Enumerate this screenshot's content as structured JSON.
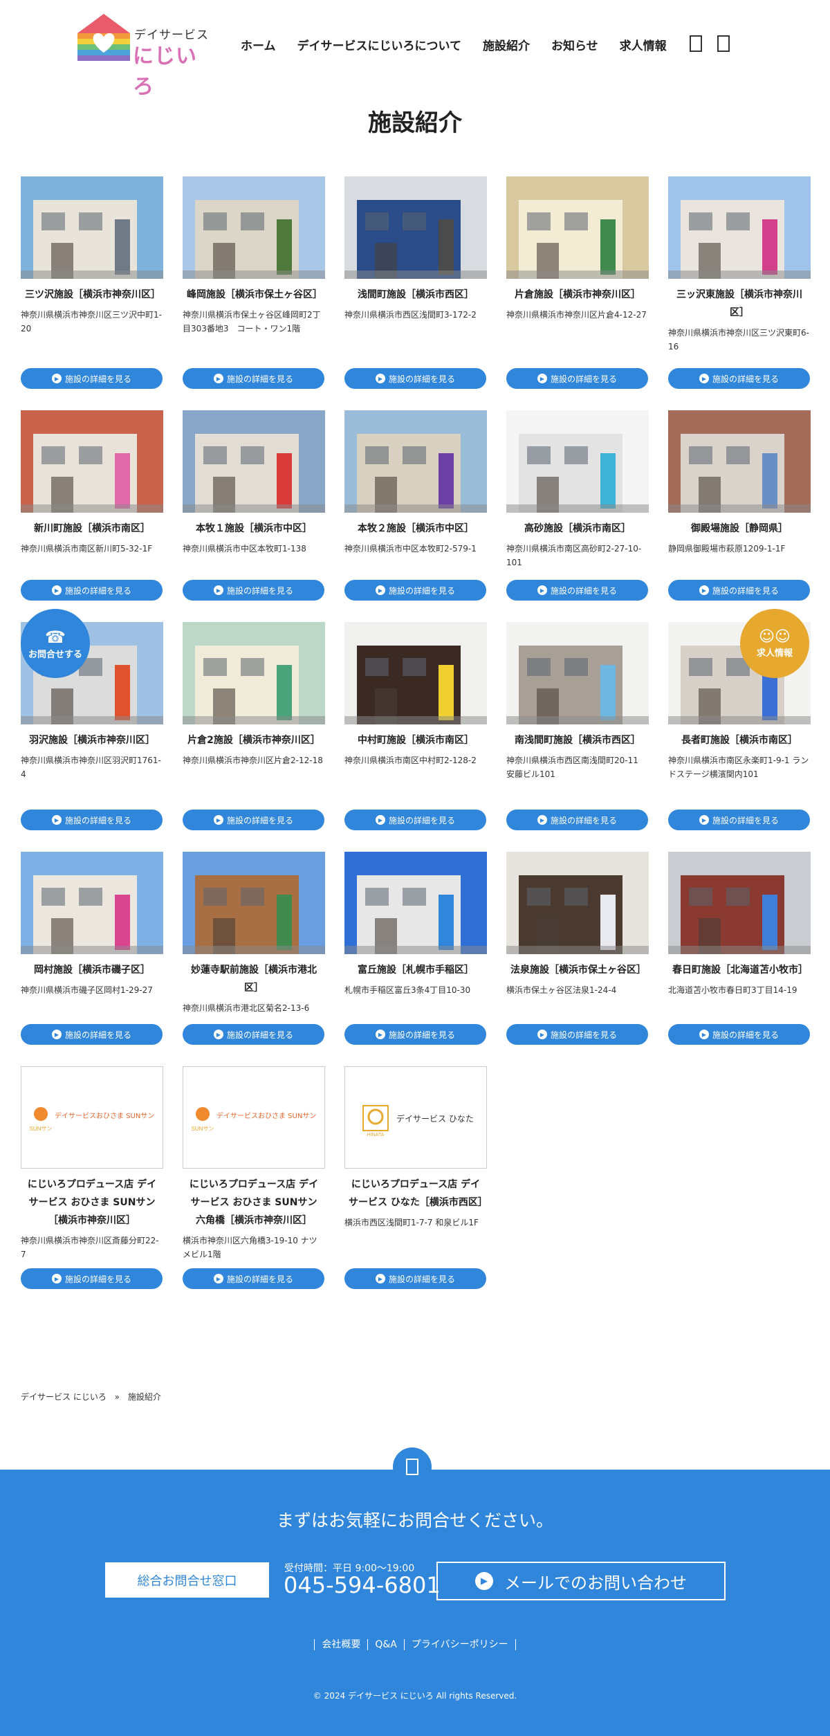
{
  "header": {
    "logo_sub": "デイサービス",
    "logo_main": "にじいろ",
    "nav": [
      "ホーム",
      "デイサービスにじいろについて",
      "施設紹介",
      "お知らせ",
      "求人情報"
    ],
    "icons": [
      "user-icon",
      "search-icon"
    ]
  },
  "page_title": "施設紹介",
  "detail_button_label": "施設の詳細を見る",
  "facilities": [
    {
      "name": "三ツ沢施設［横浜市神奈川区］",
      "address": "神奈川県横浜市神奈川区三ツ沢中町1-20"
    },
    {
      "name": "峰岡施設［横浜市保土ヶ谷区］",
      "address": "神奈川県横浜市保土ヶ谷区峰岡町2丁目303番地3　コート・ワン1階"
    },
    {
      "name": "浅間町施設［横浜市西区］",
      "address": "神奈川県横浜市西区浅間町3-172-2"
    },
    {
      "name": "片倉施設［横浜市神奈川区］",
      "address": "神奈川県横浜市神奈川区片倉4-12-27"
    },
    {
      "name": "三ッ沢東施設［横浜市神奈川区］",
      "address": "神奈川県横浜市神奈川区三ツ沢東町6-16"
    },
    {
      "name": "新川町施設［横浜市南区］",
      "address": "神奈川県横浜市南区新川町5-32-1F"
    },
    {
      "name": "本牧１施設［横浜市中区］",
      "address": "神奈川県横浜市中区本牧町1-138"
    },
    {
      "name": "本牧２施設［横浜市中区］",
      "address": "神奈川県横浜市中区本牧町2-579-1"
    },
    {
      "name": "高砂施設［横浜市南区］",
      "address": "神奈川県横浜市南区高砂町2-27-10-101"
    },
    {
      "name": "御殿場施設［静岡県］",
      "address": "静岡県御殿場市萩原1209-1-1F"
    },
    {
      "name": "羽沢施設［横浜市神奈川区］",
      "address": "神奈川県横浜市神奈川区羽沢町1761-4"
    },
    {
      "name": "片倉2施設［横浜市神奈川区］",
      "address": "神奈川県横浜市神奈川区片倉2-12-18"
    },
    {
      "name": "中村町施設［横浜市南区］",
      "address": "神奈川県横浜市南区中村町2-128-2"
    },
    {
      "name": "南浅間町施設［横浜市西区］",
      "address": "神奈川県横浜市西区南浅間町20-11 安藤ビル101"
    },
    {
      "name": "長者町施設［横浜市南区］",
      "address": "神奈川県横浜市南区永楽町1-9-1 ランドステージ横濱関内101"
    },
    {
      "name": "岡村施設［横浜市磯子区］",
      "address": "神奈川県横浜市磯子区岡村1-29-27"
    },
    {
      "name": "妙蓮寺駅前施設［横浜市港北区］",
      "address": "神奈川県横浜市港北区菊名2-13-6"
    },
    {
      "name": "富丘施設［札幌市手稲区］",
      "address": "札幌市手稲区富丘3条4丁目10-30"
    },
    {
      "name": "法泉施設［横浜市保土ヶ谷区］",
      "address": "横浜市保土ヶ谷区法泉1-24-4"
    },
    {
      "name": "春日町施設［北海道苫小牧市］",
      "address": "北海道苫小牧市春日町3丁目14-19"
    },
    {
      "name": "にじいろプロデュース店 デイサービス おひさま SUNサン［横浜市神奈川区］",
      "address": "神奈川県横浜市神奈川区斎藤分町22-7"
    },
    {
      "name": "にじいろプロデュース店 デイサービス おひさま SUNサン 六角橋［横浜市神奈川区］",
      "address": "横浜市神奈川区六角橋3-19-10 ナツメビル1階"
    },
    {
      "name": "にじいろプロデュース店 デイサービス ひなた［横浜市西区］",
      "address": "横浜市西区浅間町1-7-7 和泉ビル1F"
    }
  ],
  "logo_cards": {
    "sun_text": "デイサービスおひさま SUNサン",
    "sun_mark": "SUNサン",
    "hinata_text": "デイサービス ひなた",
    "hinata_mark": "HINATA"
  },
  "fab": {
    "contact": "お問合せする",
    "recruit": "求人情報",
    "contact_color": "#2f86da",
    "recruit_color": "#e6a82e"
  },
  "breadcrumb": [
    "デイサービス にじいろ",
    "»",
    "施設紹介"
  ],
  "footer": {
    "lead": "まずはお気軽にお問合せください。",
    "window_button": "総合お問合せ窓口",
    "hours": "受付時間：平日 9:00〜19:00",
    "tel": "045-594-6801",
    "mail_button": "メールでのお問い合わせ",
    "links": [
      "会社概要",
      "Q&A",
      "プライバシーポリシー"
    ],
    "copyright": "© 2024 デイサービス にじいろ All rights Reserved."
  },
  "colors": {
    "accent": "#2f86da",
    "footer_bg": "#2f86da"
  }
}
